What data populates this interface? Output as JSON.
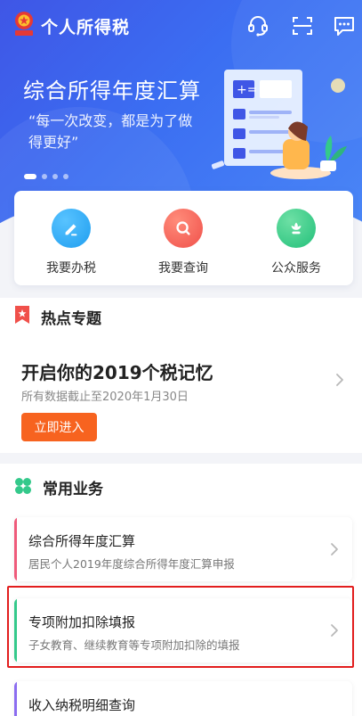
{
  "header": {
    "emblem_text": "中国税务",
    "app_title": "个人所得税"
  },
  "banner": {
    "title": "综合所得年度汇算",
    "subtitle": "“每一次改变，都是为了做得更好”",
    "slides": 4,
    "active_slide": 1
  },
  "quick_actions": [
    {
      "label": "我要办税",
      "icon": "edit-icon",
      "color": "#1f9ef0"
    },
    {
      "label": "我要查询",
      "icon": "search-icon",
      "color": "#f0504a"
    },
    {
      "label": "公众服务",
      "icon": "flower-icon",
      "color": "#22c07a"
    }
  ],
  "hot_topics": {
    "heading": "热点专题",
    "title": "开启你的2019个税记忆",
    "subtitle": "所有数据截止至2020年1月30日",
    "button": "立即进入"
  },
  "common_business": {
    "heading": "常用业务",
    "items": [
      {
        "title": "综合所得年度汇算",
        "subtitle": "居民个人2019年度综合所得年度汇算申报",
        "accent": "#ef5a7a"
      },
      {
        "title": "专项附加扣除填报",
        "subtitle": "子女教育、继续教育等专项附加扣除的填报",
        "accent": "#34c98b"
      },
      {
        "title": "收入纳税明细查询",
        "subtitle": "",
        "accent": "#8b6cf0"
      }
    ]
  },
  "colors": {
    "brand_blue": "#3f56e6",
    "orange_button": "#f7631f",
    "highlight_red": "#e21d1d"
  }
}
